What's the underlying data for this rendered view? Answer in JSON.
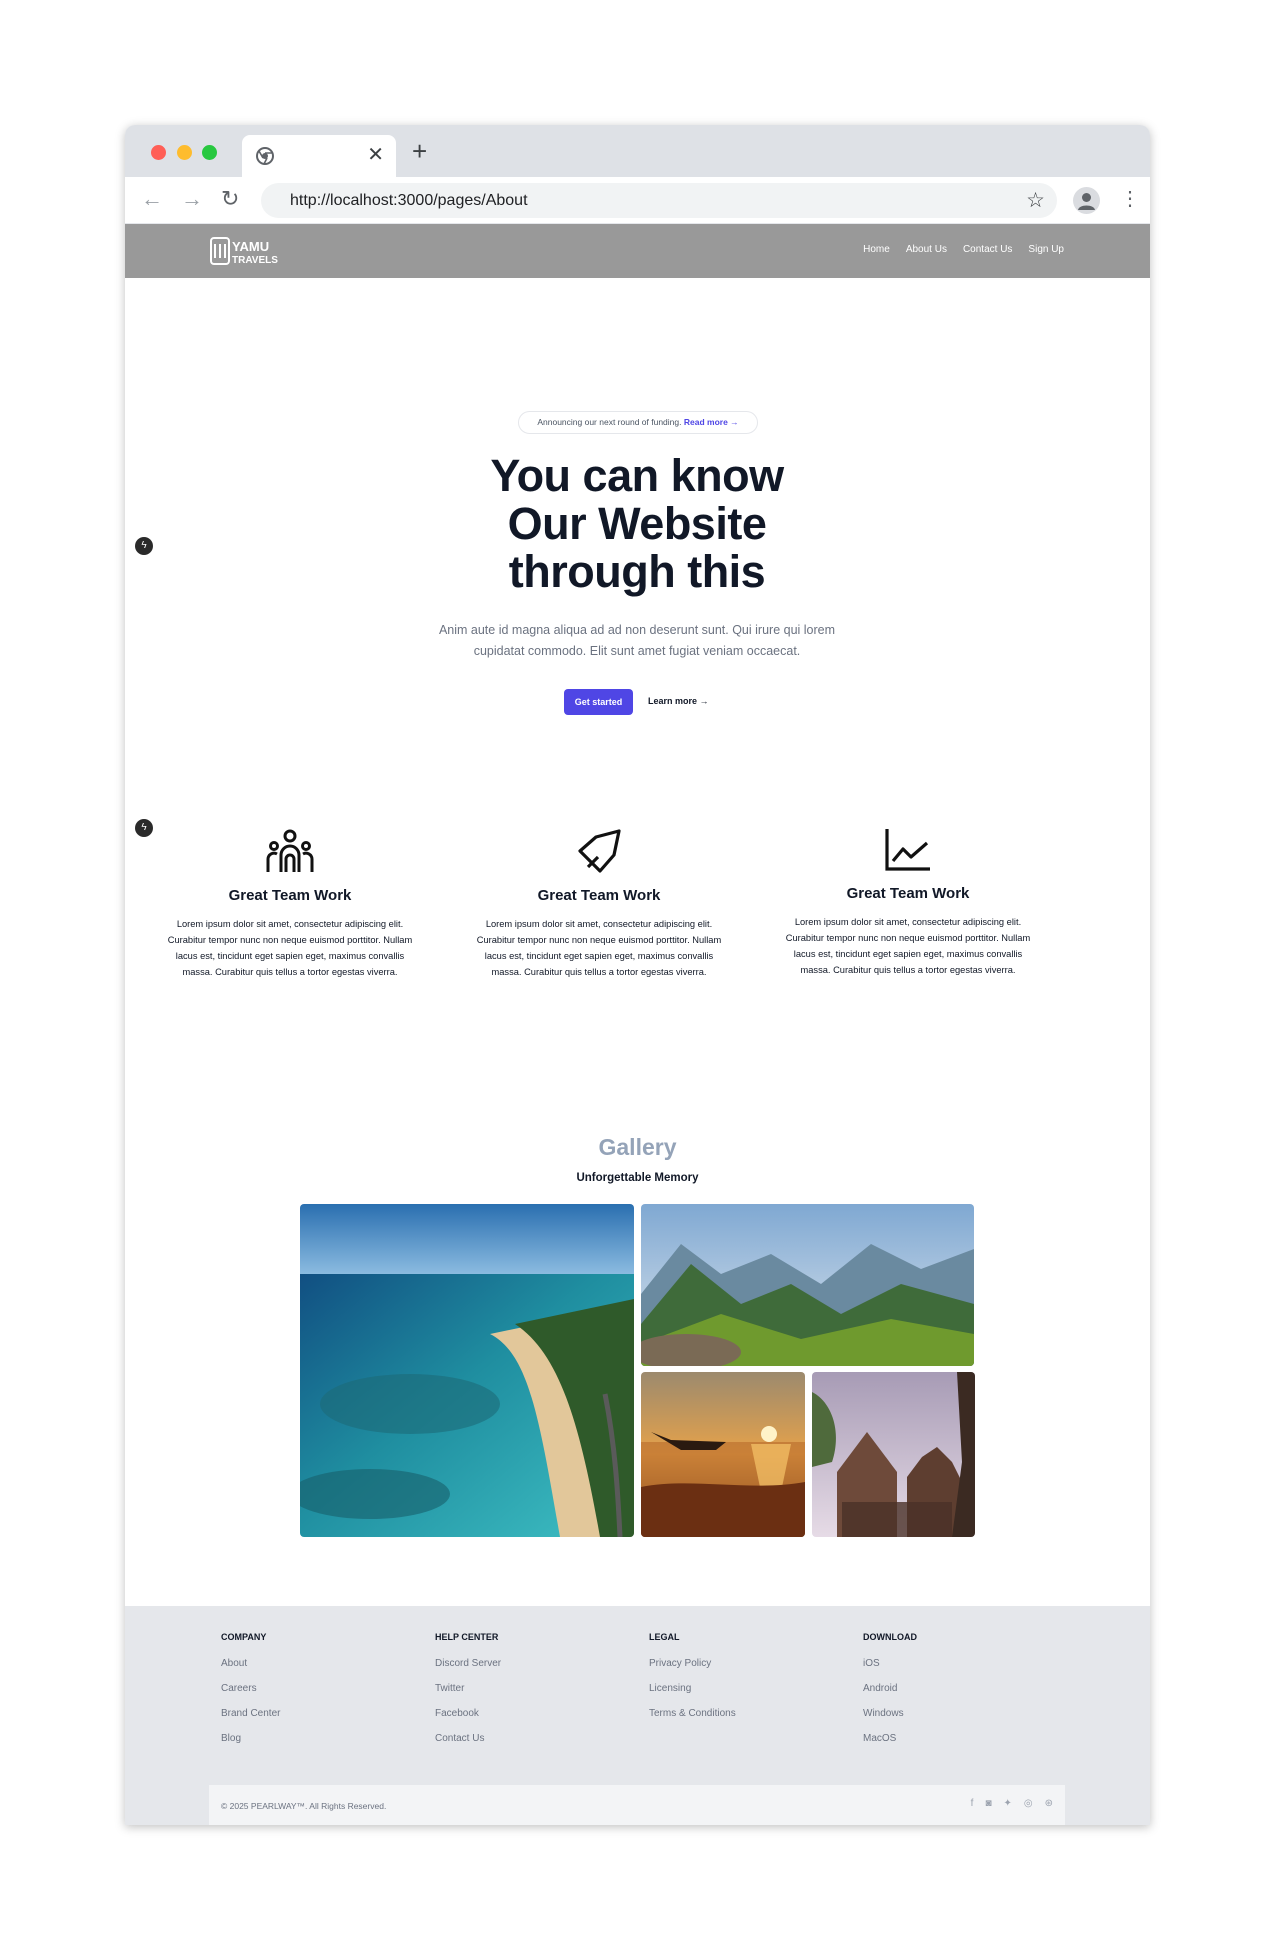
{
  "browser": {
    "url": "http://localhost:3000/pages/About",
    "controls": {
      "tab_close": "✕",
      "new_tab": "+",
      "back": "←",
      "forward": "→",
      "reload": "↻",
      "bookmark": "☆",
      "menu": "⋮"
    }
  },
  "nav": {
    "links": [
      "Home",
      "About Us",
      "Contact Us",
      "Sign Up"
    ]
  },
  "hero": {
    "announcement": "Announcing our next round of funding.",
    "announcement_link": "Read more →",
    "title_lines": [
      "You can know",
      "Our Website",
      "through this"
    ],
    "description": "Anim aute id magna aliqua ad ad non deserunt sunt. Qui irure qui lorem cupidatat commodo. Elit sunt amet fugiat veniam occaecat.",
    "cta_primary": "Get started",
    "cta_secondary": "Learn more →"
  },
  "features": [
    {
      "icon": "team-icon",
      "title": "Great Team Work",
      "text": "Lorem ipsum dolor sit amet, consectetur adipiscing elit. Curabitur tempor nunc non neque euismod porttitor. Nullam lacus est, tincidunt eget sapien eget, maximus convallis massa. Curabitur quis tellus a tortor egestas viverra."
    },
    {
      "icon": "rocket-icon",
      "title": "Great Team Work",
      "text": "Lorem ipsum dolor sit amet, consectetur adipiscing elit. Curabitur tempor nunc non neque euismod porttitor. Nullam lacus est, tincidunt eget sapien eget, maximus convallis massa. Curabitur quis tellus a tortor egestas viverra."
    },
    {
      "icon": "chart-line-icon",
      "title": "Great Team Work",
      "text": "Lorem ipsum dolor sit amet, consectetur adipiscing elit. Curabitur tempor nunc non neque euismod porttitor. Nullam lacus est, tincidunt eget sapien eget, maximus convallis massa. Curabitur quis tellus a tortor egestas viverra."
    }
  ],
  "gallery": {
    "title": "Gallery",
    "subtitle": "Unforgettable Memory"
  },
  "footer": {
    "columns": [
      {
        "heading": "COMPANY",
        "links": [
          "About",
          "Careers",
          "Brand Center",
          "Blog"
        ]
      },
      {
        "heading": "HELP CENTER",
        "links": [
          "Discord Server",
          "Twitter",
          "Facebook",
          "Contact Us"
        ]
      },
      {
        "heading": "LEGAL",
        "links": [
          "Privacy Policy",
          "Licensing",
          "Terms & Conditions"
        ]
      },
      {
        "heading": "DOWNLOAD",
        "links": [
          "iOS",
          "Android",
          "Windows",
          "MacOS"
        ]
      }
    ],
    "copyright": "© 2025 PEARLWAY™. All Rights Reserved.",
    "socials": [
      "facebook-icon",
      "discord-icon",
      "twitter-icon",
      "github-icon",
      "dribbble-icon"
    ],
    "social_glyphs": [
      "f",
      "◙",
      "✦",
      "◎",
      "⊛"
    ]
  },
  "colors": {
    "nav_bg": "#999999",
    "accent": "#4f46e5",
    "gallery_title": "#94a3b8",
    "footer_bg": "#e5e7eb"
  }
}
